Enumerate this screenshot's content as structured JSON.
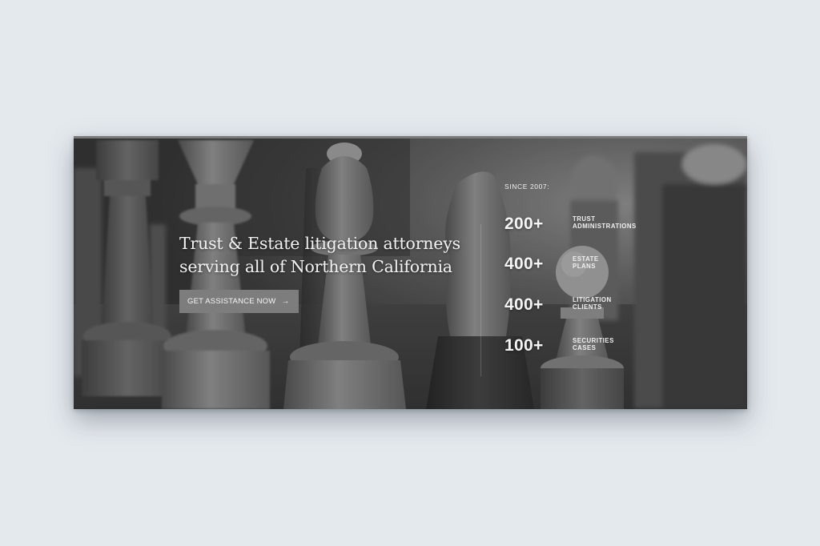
{
  "hero": {
    "headline_line1": "Trust & Estate litigation attorneys",
    "headline_line2": "serving all of Northern California",
    "cta_label": "GET ASSISTANCE NOW",
    "cta_icon": "arrow-right-icon",
    "background_image": "chess-pieces-grayscale-photo"
  },
  "stats": {
    "since_label": "SINCE 2007:",
    "items": [
      {
        "value": "200+",
        "label_line1": "TRUST",
        "label_line2": "ADMINISTRATIONS"
      },
      {
        "value": "400+",
        "label_line1": "ESTATE",
        "label_line2": "PLANS"
      },
      {
        "value": "400+",
        "label_line1": "LITIGATION",
        "label_line2": "CLIENTS"
      },
      {
        "value": "100+",
        "label_line1": "SECURITIES",
        "label_line2": "CASES"
      }
    ]
  },
  "colors": {
    "page_background": "#e4e9ee",
    "cta_background": "#7d7d7d",
    "text": "#f2f2f2"
  }
}
